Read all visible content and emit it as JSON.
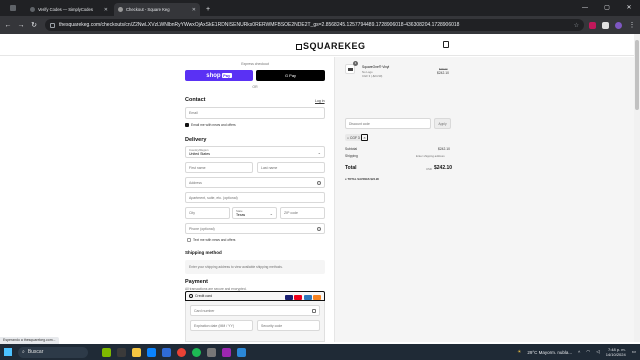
{
  "browser": {
    "tabs": [
      {
        "title": "Verify Codes — SimplyCodes",
        "active": false
      },
      {
        "title": "Checkout - Square Keg",
        "active": true
      }
    ],
    "url": "thesquarekeg.com/checkouts/cn/Z2NwLXVzLWNlbnRyYWwxOjAxSkE1RDNISENURks0RERWMFBSOE2NDE2T_gs=2.8568245.1257794489.1728906018-436308204.1728906018"
  },
  "header": {
    "logo": "SQUAREKEG"
  },
  "express": {
    "label": "Express checkout",
    "shoppay": "shop",
    "shoppay_badge": "Pay",
    "gpay": "G Pay",
    "or": "OR"
  },
  "contact": {
    "title": "Contact",
    "login": "Log in",
    "email_placeholder": "Email",
    "news_label": "Email me with news and offers"
  },
  "delivery": {
    "title": "Delivery",
    "country_label": "Country/Region",
    "country_value": "United States",
    "first_name": "First name",
    "last_name": "Last name",
    "address": "Address",
    "apartment": "Apartment, suite, etc. (optional)",
    "city": "City",
    "state_label": "State",
    "state_value": "Texas",
    "zip": "ZIP code",
    "phone": "Phone (optional)",
    "text_label": "Text me with news and offers"
  },
  "shipping": {
    "title": "Shipping method",
    "info": "Enter your shipping address to view available shipping methods."
  },
  "payment": {
    "title": "Payment",
    "subtitle": "All transactions are secure and encrypted.",
    "method": "Credit card",
    "card_number": "Card number",
    "expiry": "Expiration date (MM / YY)",
    "security": "Security code"
  },
  "summary": {
    "item_name": "SquareOne® Vinyl",
    "item_variant": "No Logo",
    "item_discount": "CGF 3 (-$24.90)",
    "item_price_old": "$28.00",
    "item_price": "$242.10",
    "qty": "1",
    "discount_placeholder": "Discount code",
    "apply": "Apply",
    "tag": "CGF 3",
    "subtotal_label": "Subtotal",
    "subtotal_value": "$242.10",
    "shipping_label": "Shipping",
    "shipping_value": "Enter shipping address",
    "total_label": "Total",
    "total_currency": "USD",
    "total_value": "$242.10",
    "savings": "TOTAL SAVINGS $24.90"
  },
  "status": {
    "text": "Esperando a thesquarekeg.com..."
  },
  "taskbar": {
    "search": "Buscar",
    "weather": "29°C  Mayorm. nubla...",
    "time": "7:48 p. m.",
    "date": "14/10/2024"
  }
}
